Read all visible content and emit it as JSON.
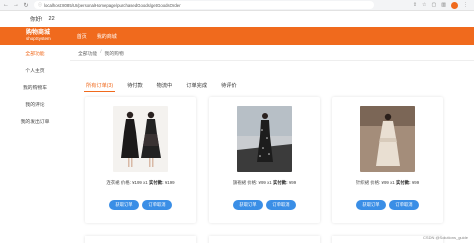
{
  "browser": {
    "url": "localhost:8085/UI/personalHomepage/purchasedGoods/getGoodsOrder"
  },
  "infobar": {
    "user": "你好!",
    "number": "22"
  },
  "header": {
    "logo_line1": "购物商城",
    "logo_line2": "shopSystem",
    "nav": [
      "首页",
      "我的商城"
    ]
  },
  "sidebar": {
    "items": [
      {
        "label": "全部功能",
        "active": true
      },
      {
        "label": "个人主页",
        "active": false
      },
      {
        "label": "我的购物车",
        "active": false
      },
      {
        "label": "我的评论",
        "active": false
      },
      {
        "label": "我的发出订单",
        "active": false
      }
    ]
  },
  "breadcrumb": {
    "root": "全部功能",
    "current": "我的购物"
  },
  "tabs": [
    {
      "label": "所有订单(3)",
      "active": true
    },
    {
      "label": "待付款",
      "active": false
    },
    {
      "label": "物流中",
      "active": false
    },
    {
      "label": "订单完成",
      "active": false
    },
    {
      "label": "待评价",
      "active": false
    }
  ],
  "orders": [
    {
      "name": "连衣裙",
      "price_label": "价格:",
      "price": "¥199",
      "qty": "x1",
      "paid_label": "实付款:",
      "paid": "¥199",
      "btn_pay": "获取订单",
      "btn_cancel": "订单取消"
    },
    {
      "name": "旗袍裙",
      "price_label": "价格:",
      "price": "¥99",
      "qty": "x1",
      "paid_label": "实付款:",
      "paid": "¥99",
      "btn_pay": "获取订单",
      "btn_cancel": "订单取消"
    },
    {
      "name": "针织裙",
      "price_label": "价格:",
      "price": "¥99",
      "qty": "x1",
      "paid_label": "实付款:",
      "paid": "¥99",
      "btn_pay": "获取订单",
      "btn_cancel": "订单取消"
    }
  ],
  "watermark": "CSDN @Solutions_guide",
  "colors": {
    "brand": "#f06a1d",
    "button": "#3a8ee6"
  }
}
